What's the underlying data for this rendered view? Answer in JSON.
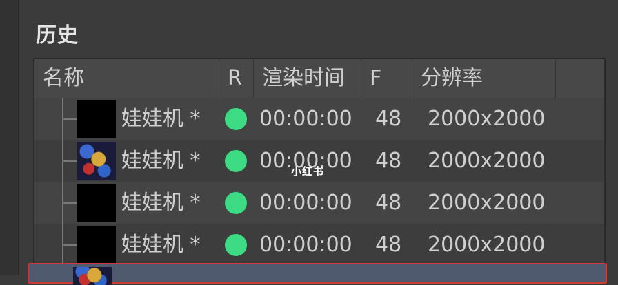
{
  "panel": {
    "title": "历史"
  },
  "columns": [
    "名称",
    "R",
    "渲染时间",
    "F",
    "分辨率"
  ],
  "colors": {
    "status_ready": "#3ddc84"
  },
  "rows": [
    {
      "name": "娃娃机 *",
      "render_time": "00:00:00",
      "frames": "48",
      "resolution": "2000x2000",
      "thumbnail": "black"
    },
    {
      "name": "娃娃机 *",
      "render_time": "00:00:00",
      "frames": "48",
      "resolution": "2000x2000",
      "thumbnail": "scene-preview"
    },
    {
      "name": "娃娃机 *",
      "render_time": "00:00:00",
      "frames": "48",
      "resolution": "2000x2000",
      "thumbnail": "black"
    },
    {
      "name": "娃娃机 *",
      "render_time": "00:00:00",
      "frames": "48",
      "resolution": "2000x2000",
      "thumbnail": "black"
    }
  ],
  "watermark": "小红书"
}
